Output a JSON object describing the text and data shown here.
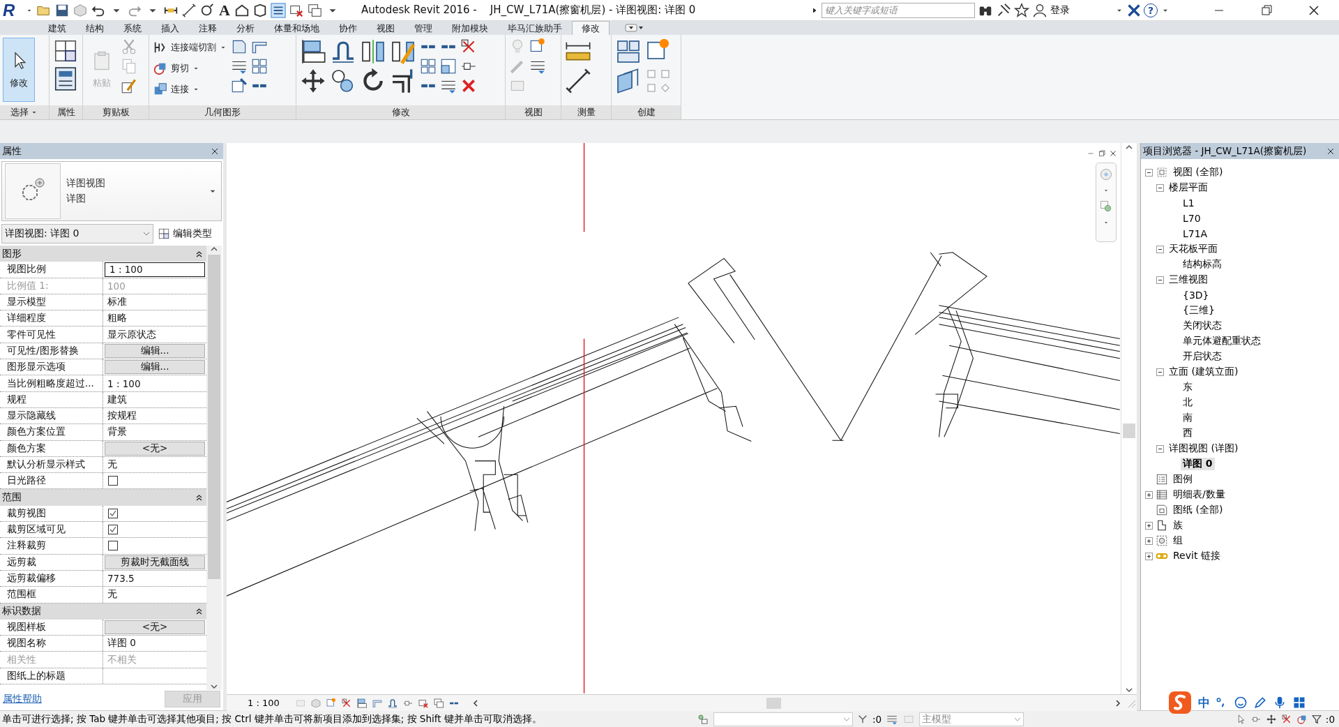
{
  "app": {
    "logo": "R",
    "text_tool": "A"
  },
  "window": {
    "title": "Autodesk Revit 2016 -    JH_CW_L71A(擦窗机层) - 详图视图: 详图 0",
    "search_placeholder": "键入关键字或短语",
    "sign_in": "登录",
    "help": "?"
  },
  "ribbon": {
    "tabs": [
      {
        "label": "建筑",
        "selected": false
      },
      {
        "label": "结构",
        "selected": false
      },
      {
        "label": "系统",
        "selected": false
      },
      {
        "label": "插入",
        "selected": false
      },
      {
        "label": "注释",
        "selected": false
      },
      {
        "label": "分析",
        "selected": false
      },
      {
        "label": "体量和场地",
        "selected": false
      },
      {
        "label": "协作",
        "selected": false
      },
      {
        "label": "视图",
        "selected": false
      },
      {
        "label": "管理",
        "selected": false
      },
      {
        "label": "附加模块",
        "selected": false
      },
      {
        "label": "毕马汇族助手",
        "selected": false
      },
      {
        "label": "修改",
        "selected": true
      }
    ],
    "panels": [
      {
        "label": "选择",
        "menu": true,
        "buttons": [
          {
            "label": "修改",
            "on": true
          }
        ]
      },
      {
        "label": "属性"
      },
      {
        "label": "剪贴板",
        "buttons": [
          {
            "label": "粘贴",
            "disabled": true
          }
        ]
      },
      {
        "label": "几何图形",
        "buttons": [
          {
            "label": "连接端切割"
          },
          {
            "label": "剪切"
          },
          {
            "label": "连接"
          }
        ]
      },
      {
        "label": "修改"
      },
      {
        "label": "视图"
      },
      {
        "label": "测量"
      },
      {
        "label": "创建"
      }
    ]
  },
  "properties": {
    "title": "属性",
    "type_name": "详图视图",
    "type_sub": "详图",
    "instance": "详图视图: 详图 0",
    "edit_type": "编辑类型",
    "groups": [
      {
        "title": "图形",
        "rows": [
          {
            "label": "视图比例",
            "kind": "field",
            "value": "1 : 100",
            "disabled": false
          },
          {
            "label": "比例值 1:",
            "kind": "text",
            "value": "100",
            "disabled": true
          },
          {
            "label": "显示模型",
            "kind": "text",
            "value": "标准",
            "disabled": false
          },
          {
            "label": "详细程度",
            "kind": "text",
            "value": "粗略",
            "disabled": false
          },
          {
            "label": "零件可见性",
            "kind": "text",
            "value": "显示原状态",
            "disabled": false
          },
          {
            "label": "可见性/图形替换",
            "kind": "button",
            "value": "编辑...",
            "disabled": false
          },
          {
            "label": "图形显示选项",
            "kind": "button",
            "value": "编辑...",
            "disabled": false
          },
          {
            "label": "当比例粗略度超过...",
            "kind": "text",
            "value": "1 : 100",
            "disabled": false
          },
          {
            "label": "规程",
            "kind": "text",
            "value": "建筑",
            "disabled": false
          },
          {
            "label": "显示隐藏线",
            "kind": "text",
            "value": "按规程",
            "disabled": false
          },
          {
            "label": "颜色方案位置",
            "kind": "text",
            "value": "背景",
            "disabled": false
          },
          {
            "label": "颜色方案",
            "kind": "button",
            "value": "<无>",
            "disabled": false
          },
          {
            "label": "默认分析显示样式",
            "kind": "text",
            "value": "无",
            "disabled": false
          },
          {
            "label": "日光路径",
            "kind": "check",
            "checked": false,
            "disabled": false
          }
        ]
      },
      {
        "title": "范围",
        "rows": [
          {
            "label": "裁剪视图",
            "kind": "check",
            "checked": true,
            "disabled": false
          },
          {
            "label": "裁剪区域可见",
            "kind": "check",
            "checked": true,
            "disabled": false
          },
          {
            "label": "注释裁剪",
            "kind": "check",
            "checked": false,
            "disabled": false
          },
          {
            "label": "远剪裁",
            "kind": "button",
            "value": "剪裁时无截面线",
            "disabled": false
          },
          {
            "label": "远剪裁偏移",
            "kind": "text",
            "value": "773.5",
            "disabled": false
          },
          {
            "label": "范围框",
            "kind": "text",
            "value": "无",
            "disabled": false
          }
        ]
      },
      {
        "title": "标识数据",
        "rows": [
          {
            "label": "视图样板",
            "kind": "button",
            "value": "<无>",
            "disabled": false
          },
          {
            "label": "视图名称",
            "kind": "text",
            "value": "详图 0",
            "disabled": false
          },
          {
            "label": "相关性",
            "kind": "text",
            "value": "不相关",
            "disabled": true
          },
          {
            "label": "图纸上的标题",
            "kind": "text",
            "disabled": false
          }
        ]
      }
    ],
    "help": "属性帮助",
    "apply": "应用",
    "apply_disabled": true
  },
  "view_bar": {
    "scale": "1 : 100"
  },
  "project_browser": {
    "title": "项目浏览器 - JH_CW_L71A(擦窗机层)",
    "tree": [
      {
        "label": "视图 (全部)",
        "kind": "views",
        "expanded": true,
        "selected": false,
        "children": [
          {
            "label": "楼层平面",
            "expanded": true,
            "selected": false,
            "children": [
              {
                "label": "L1",
                "selected": false
              },
              {
                "label": "L70",
                "selected": false
              },
              {
                "label": "L71A",
                "selected": false
              }
            ]
          },
          {
            "label": "天花板平面",
            "expanded": true,
            "selected": false,
            "children": [
              {
                "label": "结构标高",
                "selected": false
              }
            ]
          },
          {
            "label": "三维视图",
            "expanded": true,
            "selected": false,
            "children": [
              {
                "label": "{3D}",
                "selected": false
              },
              {
                "label": "{三维}",
                "selected": false
              },
              {
                "label": "关闭状态",
                "selected": false
              },
              {
                "label": "单元体避配重状态",
                "selected": false
              },
              {
                "label": "开启状态",
                "selected": false
              }
            ]
          },
          {
            "label": "立面 (建筑立面)",
            "expanded": true,
            "selected": false,
            "children": [
              {
                "label": "东",
                "selected": false
              },
              {
                "label": "北",
                "selected": false
              },
              {
                "label": "南",
                "selected": false
              },
              {
                "label": "西",
                "selected": false
              }
            ]
          },
          {
            "label": "详图视图 (详图)",
            "expanded": true,
            "selected": false,
            "children": [
              {
                "label": "详图 0",
                "selected": true
              }
            ]
          }
        ]
      },
      {
        "label": "图例",
        "kind": "legends",
        "selected": false
      },
      {
        "label": "明细表/数量",
        "kind": "schedules",
        "expanded": false,
        "selected": false
      },
      {
        "label": "图纸 (全部)",
        "kind": "sheets",
        "selected": false
      },
      {
        "label": "族",
        "kind": "families",
        "expanded": false,
        "selected": false
      },
      {
        "label": "组",
        "kind": "groups",
        "expanded": false,
        "selected": false
      },
      {
        "label": "Revit 链接",
        "kind": "links",
        "expanded": false,
        "selected": false
      }
    ]
  },
  "status_bar": {
    "message": "单击可进行选择; 按 Tab 键并单击可选择其他项目; 按 Ctrl 键并单击可将新项目添加到选择集; 按 Shift 键并单击可取消选择。",
    "selection_count": ":0",
    "model": "主模型",
    "filter_count": ":0"
  },
  "ime_bar": {
    "mode": "中"
  }
}
